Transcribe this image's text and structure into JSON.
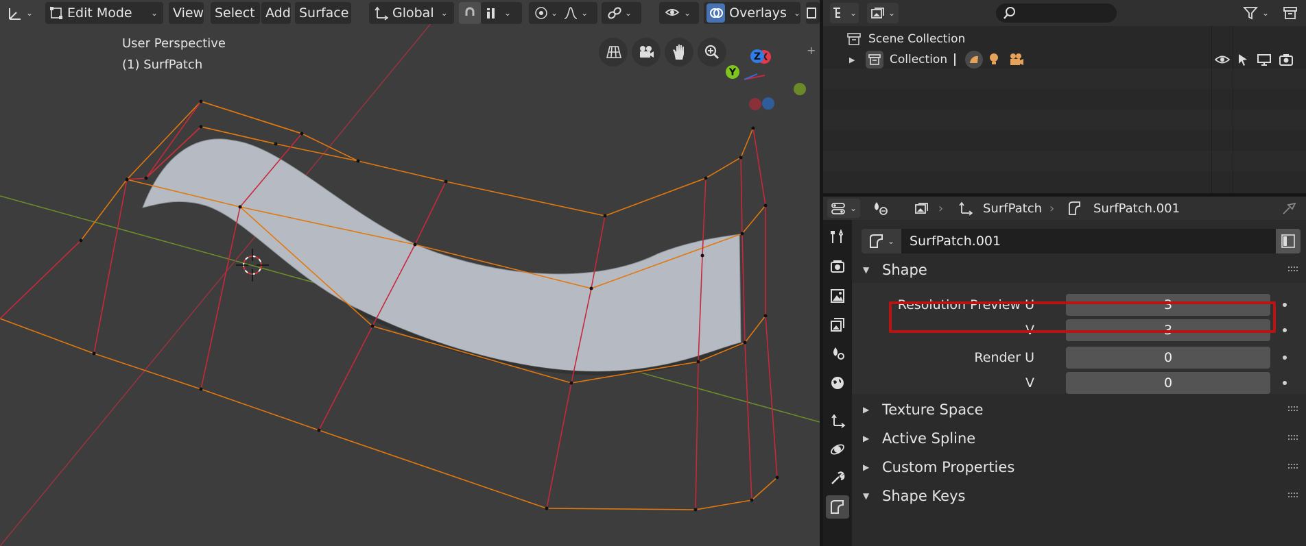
{
  "viewport": {
    "header": {
      "mode": "Edit Mode",
      "menus": [
        "View",
        "Select",
        "Add",
        "Surface"
      ],
      "transform_orientation": "Global",
      "overlays": "Overlays"
    },
    "info_line1": "User Perspective",
    "info_line2": "(1) SurfPatch",
    "gizmo": {
      "z": "Z",
      "x": "X",
      "y": "Y"
    },
    "colors": {
      "bg": "#3d3d3d",
      "edge_orange": "#e0780f",
      "edge_red": "#c8283c",
      "surface": "#b9bec6"
    }
  },
  "outliner": {
    "scene_collection": "Scene Collection",
    "collection": "Collection"
  },
  "properties": {
    "breadcrumb": {
      "object": "SurfPatch",
      "data": "SurfPatch.001"
    },
    "datablock_name": "SurfPatch.001",
    "panels": {
      "shape": "Shape",
      "texture_space": "Texture Space",
      "active_spline": "Active Spline",
      "custom_properties": "Custom Properties",
      "shape_keys": "Shape Keys"
    },
    "shape_fields": {
      "res_preview_u_label": "Resolution Preview U",
      "res_preview_u_value": "3",
      "res_preview_v_label": "V",
      "res_preview_v_value": "3",
      "render_u_label": "Render U",
      "render_u_value": "0",
      "render_v_label": "V",
      "render_v_value": "0"
    },
    "highlight_color": "#b81414"
  }
}
